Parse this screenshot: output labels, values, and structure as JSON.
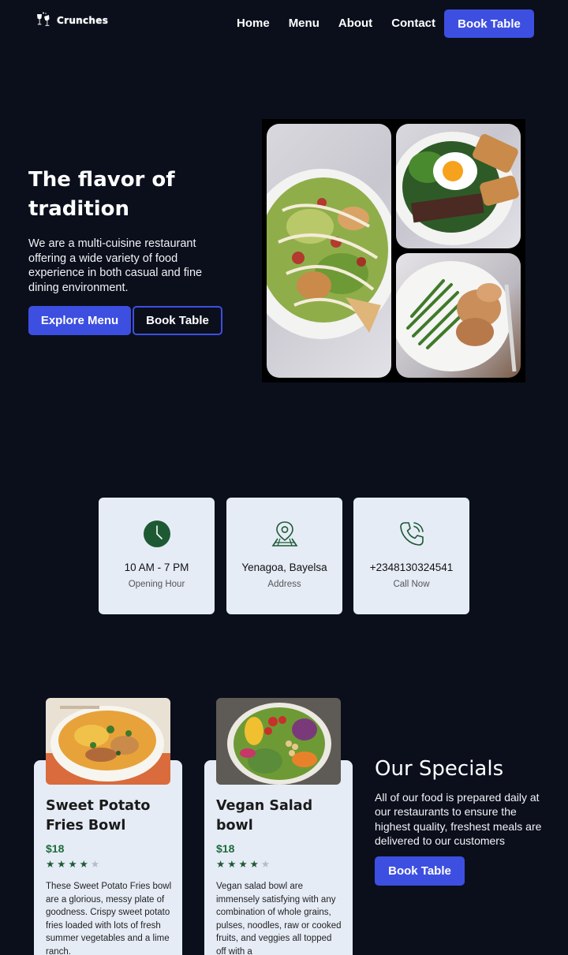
{
  "nav": {
    "logo_text": "Crunches",
    "links": [
      "Home",
      "Menu",
      "About",
      "Contact"
    ],
    "cta": "Book Table"
  },
  "hero": {
    "title": "The flavor of tradition",
    "description": "We are a multi-cuisine restaurant offering a wide variety of food experience in both casual and fine dining environment.",
    "primary_button": "Explore Menu",
    "secondary_button": "Book Table"
  },
  "info": [
    {
      "icon": "clock-icon",
      "title": "10 AM - 7 PM",
      "subtitle": "Opening Hour"
    },
    {
      "icon": "map-pin-icon",
      "title": "Yenagoa, Bayelsa",
      "subtitle": "Address"
    },
    {
      "icon": "phone-icon",
      "title": "+2348130324541",
      "subtitle": "Call Now"
    }
  ],
  "specials": {
    "title": "Our Specials",
    "description": "All of our food is prepared daily at our restaurants to ensure the highest quality, freshest meals are delivered to our customers",
    "button": "Book Table",
    "items": [
      {
        "name": "Sweet Potato Fries Bowl",
        "price": "$18",
        "rating": 4,
        "max_rating": 5,
        "description": "These Sweet Potato Fries bowl are a glorious, messy plate of goodness. Crispy sweet potato fries loaded with lots of fresh summer vegetables and a lime ranch."
      },
      {
        "name": "Vegan Salad bowl",
        "price": "$18",
        "rating": 4,
        "max_rating": 5,
        "description": "Vegan salad bowl are immensely satisfying with any combination of whole grains, pulses, noodles, raw or cooked fruits, and veggies all topped off with a"
      }
    ]
  },
  "colors": {
    "background": "#0b0f1c",
    "accent": "#3d4fe0",
    "card": "#e6ecf6",
    "icon_green": "#1d5a33"
  }
}
